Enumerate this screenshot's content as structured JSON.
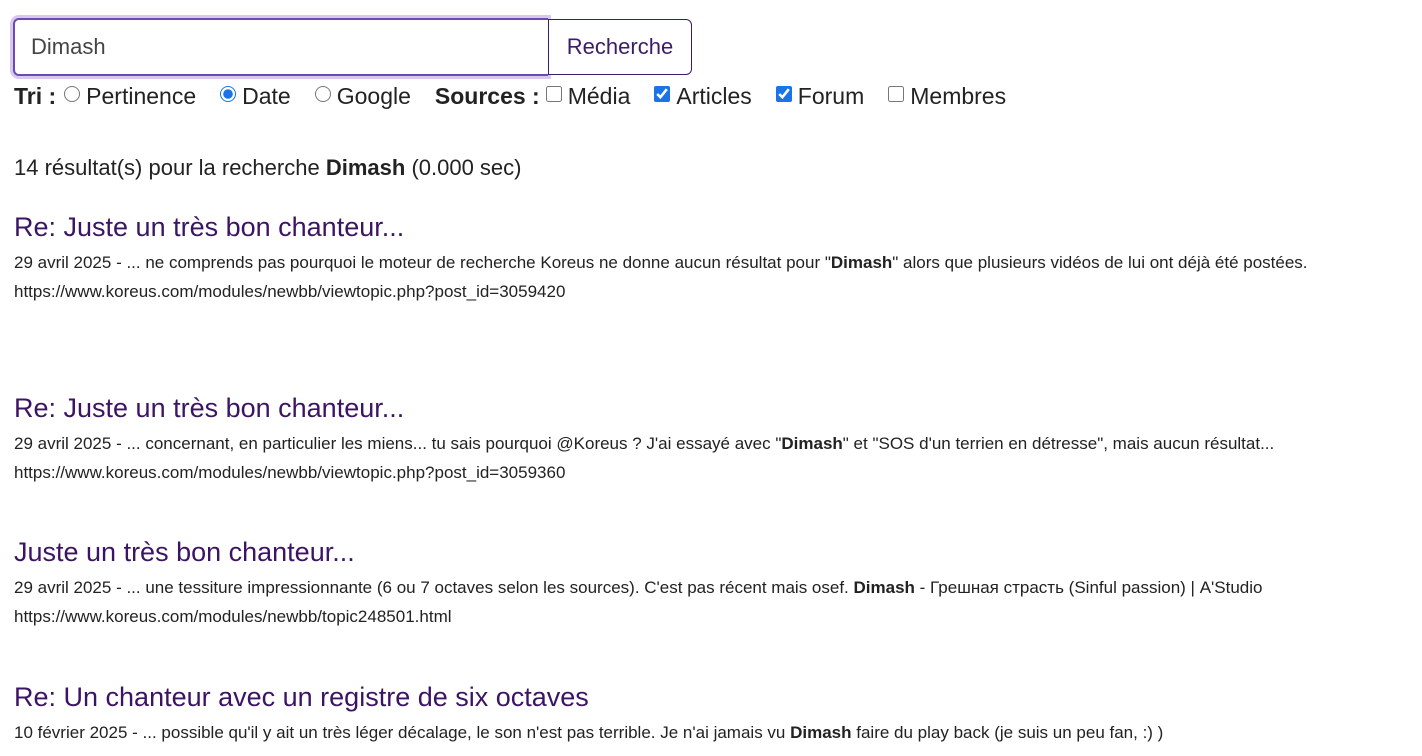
{
  "search": {
    "value": "Dimash",
    "button_label": "Recherche"
  },
  "sort": {
    "label": "Tri :",
    "options": [
      "Pertinence",
      "Date",
      "Google"
    ],
    "selected": "Date"
  },
  "sources": {
    "label": "Sources :",
    "items": [
      {
        "label": "Média",
        "checked": false
      },
      {
        "label": "Articles",
        "checked": true
      },
      {
        "label": "Forum",
        "checked": true
      },
      {
        "label": "Membres",
        "checked": false
      }
    ]
  },
  "summary": {
    "prefix": "14 résultat(s) pour la recherche",
    "query": "Dimash",
    "time": "(0.000 sec)"
  },
  "results": [
    {
      "title": "Re: Juste un très bon chanteur...",
      "snippet_before": "29 avril 2025 - ... ne comprends pas pourquoi le moteur de recherche Koreus ne donne aucun résultat pour \"",
      "highlight": "Dimash",
      "snippet_after": "\" alors que plusieurs vidéos de lui ont déjà été postées.",
      "url": "https://www.koreus.com/modules/newbb/viewtopic.php?post_id=3059420"
    },
    {
      "title": "Re: Juste un très bon chanteur...",
      "snippet_before": "29 avril 2025 - ... concernant, en particulier les miens... tu sais pourquoi @Koreus ? J'ai essayé avec \"",
      "highlight": "Dimash",
      "snippet_after": "\" et \"SOS d'un terrien en détresse\", mais aucun résultat...",
      "url": "https://www.koreus.com/modules/newbb/viewtopic.php?post_id=3059360"
    },
    {
      "title": "Juste un très bon chanteur...",
      "snippet_before": "29 avril 2025 - ... une tessiture impressionnante (6 ou 7 octaves selon les sources). C'est pas récent mais osef. ",
      "highlight": "Dimash",
      "snippet_after": " - Грешная страсть (Sinful passion) | A'Studio",
      "url": "https://www.koreus.com/modules/newbb/topic248501.html"
    },
    {
      "title": "Re: Un chanteur avec un registre de six octaves",
      "snippet_before": "10 février 2025 - ... possible qu'il y ait un très léger décalage, le son n'est pas terrible. Je n'ai jamais vu ",
      "highlight": "Dimash",
      "snippet_after": " faire du play back (je suis un peu fan, :) )",
      "url": ""
    }
  ]
}
